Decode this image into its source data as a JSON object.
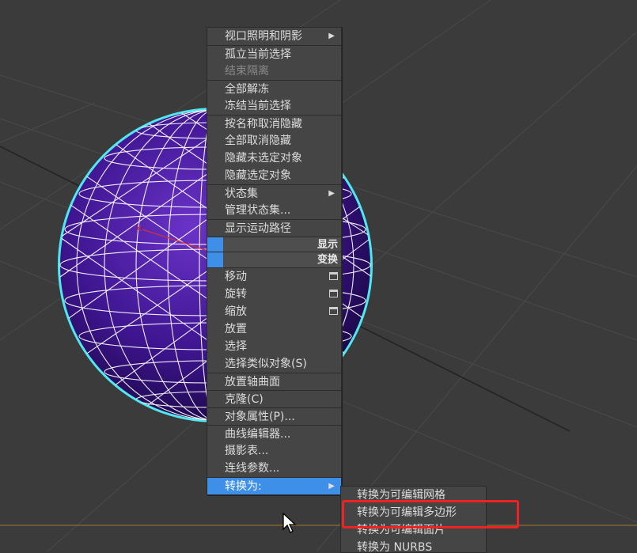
{
  "colors": {
    "viewport_bg": "#3a3a3a",
    "sphere_fill": "#4a1d9e",
    "sphere_outline": "#4ee8f0",
    "wire": "#ffffff",
    "menu_bg": "#454545",
    "highlight": "#3d8fe8",
    "red_box": "#e22222"
  },
  "menu": {
    "display_section": {
      "items": [
        {
          "label": "视口照明和阴影",
          "submenu": true
        },
        {
          "label": "孤立当前选择"
        },
        {
          "label": "结束隔离",
          "disabled": true
        },
        {
          "label": "全部解冻"
        },
        {
          "label": "冻结当前选择"
        },
        {
          "label": "按名称取消隐藏"
        },
        {
          "label": "全部取消隐藏"
        },
        {
          "label": "隐藏未选定对象"
        },
        {
          "label": "隐藏选定对象"
        },
        {
          "label": "状态集",
          "submenu": true
        },
        {
          "label": "管理状态集..."
        },
        {
          "label": "显示运动路径"
        }
      ],
      "header": "显示"
    },
    "transform_section": {
      "header": "变换",
      "items": [
        {
          "label": "移动",
          "option_box": true
        },
        {
          "label": "旋转",
          "option_box": true
        },
        {
          "label": "缩放",
          "option_box": true
        },
        {
          "label": "放置"
        },
        {
          "label": "选择"
        },
        {
          "label": "选择类似对象(S)"
        },
        {
          "label": "放置轴曲面"
        },
        {
          "label": "克隆(C)"
        },
        {
          "label": "对象属性(P)..."
        },
        {
          "label": "曲线编辑器..."
        },
        {
          "label": "摄影表..."
        },
        {
          "label": "连线参数..."
        },
        {
          "label": "转换为:",
          "submenu": true,
          "highlighted": true
        }
      ]
    },
    "convert_submenu": [
      "转换为可编辑网格",
      "转换为可编辑多边形",
      "转换为可编辑面片",
      "转换为 NURBS"
    ]
  },
  "icons": {
    "submenu_arrow": "▶",
    "cursor": "mouse-pointer-icon",
    "option_box": "window-icon"
  }
}
